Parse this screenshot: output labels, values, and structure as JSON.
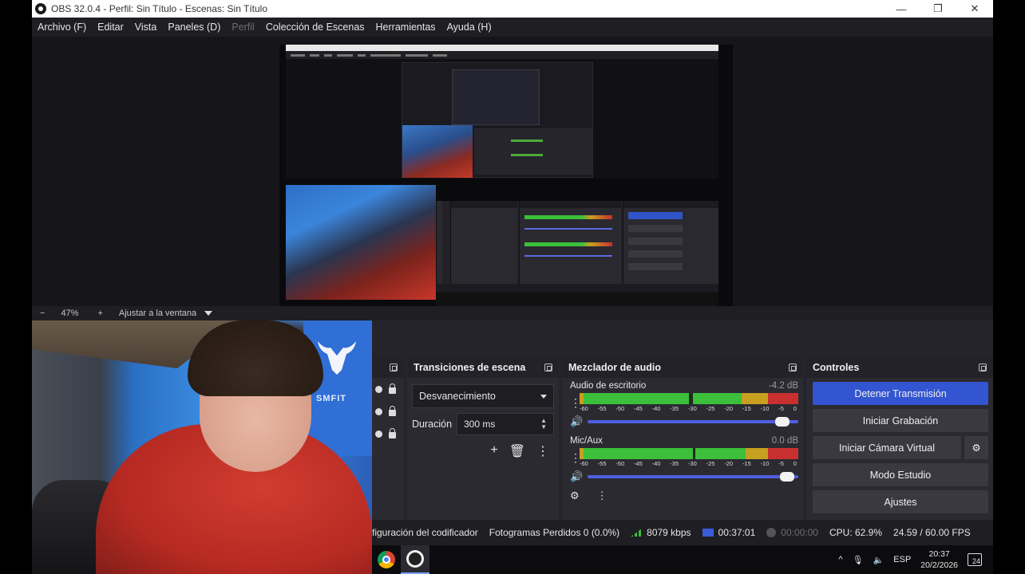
{
  "window": {
    "title": "OBS 32.0.4 - Perfil: Sin Título - Escenas: Sin Título",
    "minimize": "—",
    "maximize": "❐",
    "close": "✕"
  },
  "menu": [
    {
      "label": "Archivo (F)",
      "enabled": true
    },
    {
      "label": "Editar",
      "enabled": true
    },
    {
      "label": "Vista",
      "enabled": true
    },
    {
      "label": "Paneles (D)",
      "enabled": true
    },
    {
      "label": "Perfil",
      "enabled": false
    },
    {
      "label": "Colección de Escenas",
      "enabled": true
    },
    {
      "label": "Herramientas",
      "enabled": true
    },
    {
      "label": "Ayuda (H)",
      "enabled": true
    }
  ],
  "zoom": {
    "minus": "−",
    "value": "47%",
    "plus": "+",
    "fit_label": "Ajustar a la ventana"
  },
  "transitions": {
    "title": "Transiciones de escena",
    "selected": "Desvanecimiento",
    "duration_label": "Duración",
    "duration_value": "300 ms",
    "add": "+",
    "delete": "🗑",
    "more": "⋮"
  },
  "audio": {
    "title": "Mezclador de audio",
    "ticks": [
      "-60",
      "-55",
      "-50",
      "-45",
      "-40",
      "-35",
      "-30",
      "-25",
      "-20",
      "-15",
      "-10",
      "-5",
      "0"
    ],
    "tracks": [
      {
        "name": "Audio de escritorio",
        "db": "-4.2 dB",
        "level": 0.97,
        "volume": 0.96
      },
      {
        "name": "Mic/Aux",
        "db": "0.0 dB",
        "level": 0.96,
        "volume": 0.98
      }
    ],
    "settings_icon": "gear-icon",
    "more": "⋮"
  },
  "controls": {
    "title": "Controles",
    "stop_stream": "Detener Transmisión",
    "start_recording": "Iniciar Grabación",
    "start_virtual_cam": "Iniciar Cámara Virtual",
    "studio_mode": "Modo Estudio",
    "settings": "Ajustes",
    "accent": "#3355d1"
  },
  "status": {
    "encoder": "figuración del codificador",
    "dropped": "Fotogramas Perdidos 0 (0.0%)",
    "bitrate": "8079 kbps",
    "stream_time": "00:37:01",
    "rec_time": "00:00:00",
    "cpu": "CPU: 62.9%",
    "fps": "24.59 / 60.00 FPS"
  },
  "taskbar": {
    "apps": [
      "chrome-icon",
      "obs-icon"
    ],
    "tray_caret": "^",
    "lang": "ESP",
    "time": "20:37",
    "date": "20/2/2026",
    "notifications": "24"
  },
  "webcam": {
    "shirt_text": "SMFIT"
  }
}
